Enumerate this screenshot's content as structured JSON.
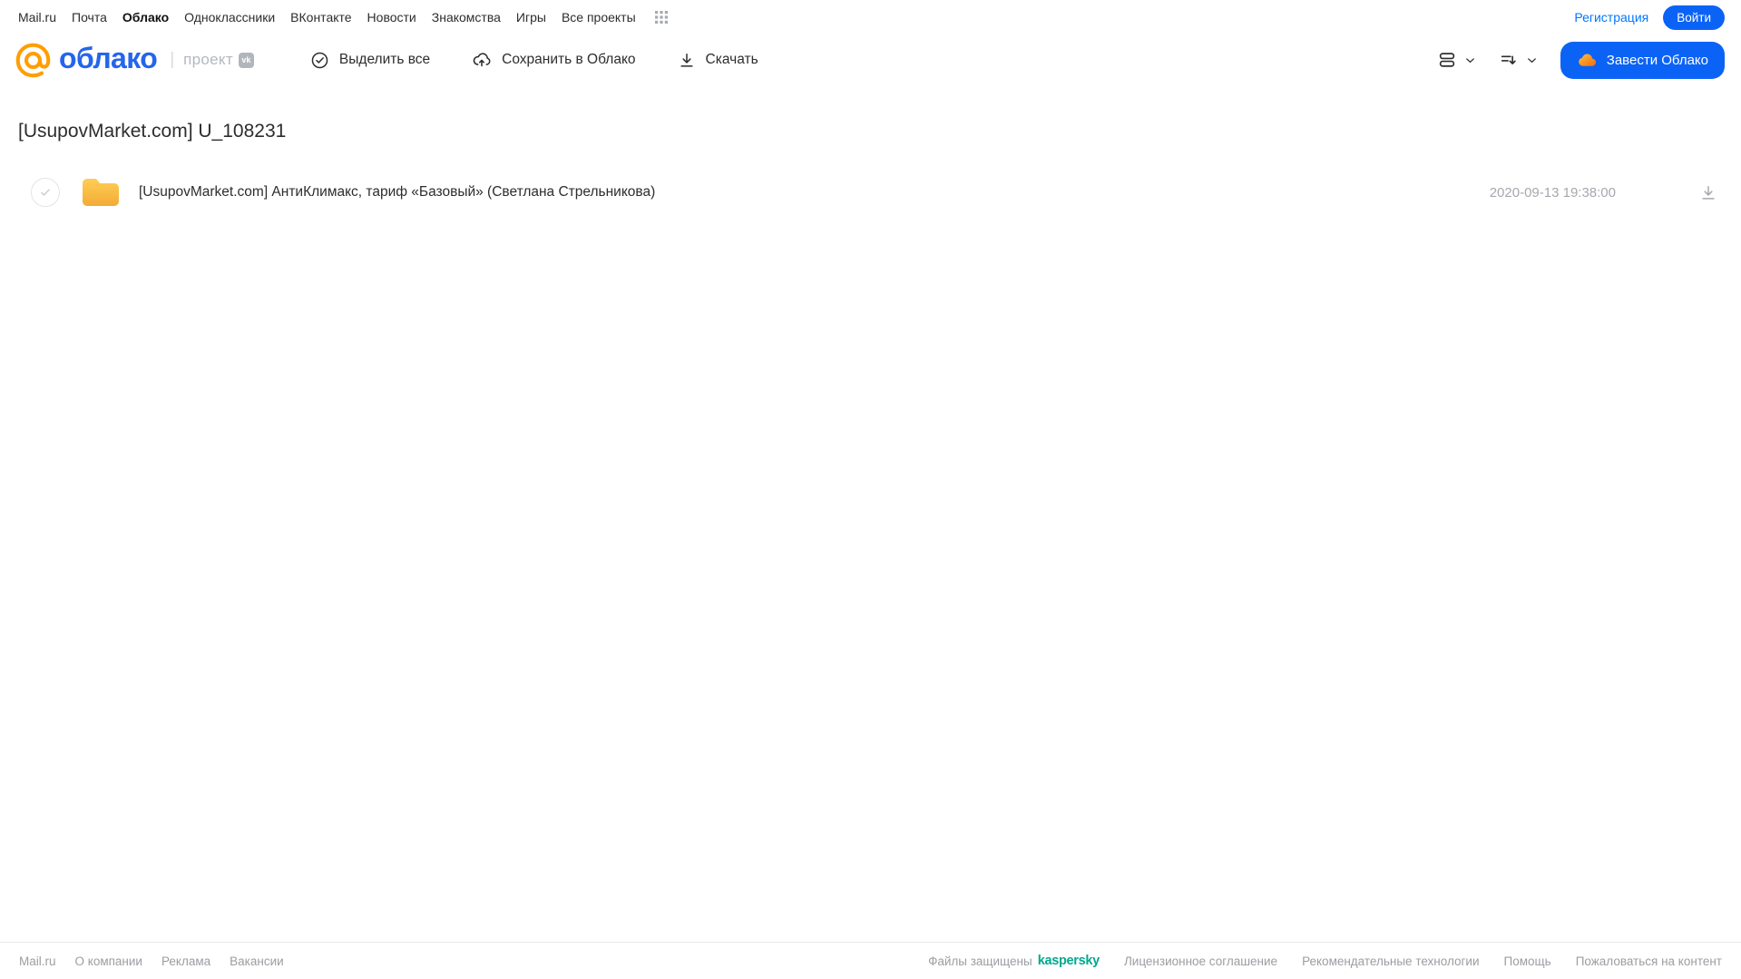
{
  "topnav": {
    "links": [
      "Mail.ru",
      "Почта",
      "Облако",
      "Одноклассники",
      "ВКонтакте",
      "Новости",
      "Знакомства",
      "Игры",
      "Все проекты"
    ],
    "register": "Регистрация",
    "login": "Войти"
  },
  "toolbar": {
    "brand": "облако",
    "divider": "|",
    "project": "проект",
    "vk_badge": "vk",
    "select_all": "Выделить все",
    "save_to_cloud": "Сохранить в Облако",
    "download": "Скачать",
    "create_cloud": "Завести Облако"
  },
  "main": {
    "title": "[UsupovMarket.com] U_108231",
    "files": [
      {
        "type": "folder",
        "name": "[UsupovMarket.com] АнтиКлимакс, тариф «Базовый» (Светлана Стрельникова)",
        "modified": "2020-09-13 19:38:00"
      }
    ]
  },
  "footer": {
    "left_links": [
      "Mail.ru",
      "О компании",
      "Реклама",
      "Вакансии"
    ],
    "protected_text": "Файлы защищены",
    "kaspersky_brand": "kaspersky",
    "right_links": [
      "Лицензионное соглашение",
      "Рекомендательные технологии",
      "Помощь",
      "Пожаловаться на контент"
    ]
  },
  "icons": {
    "grid": "apps-grid-icon",
    "select_all": "check-circle-icon",
    "save": "cloud-upload-icon",
    "download": "download-icon",
    "view": "view-rows-icon",
    "sort": "sort-icon",
    "cloud": "cloud-icon",
    "folder": "folder-icon"
  },
  "colors": {
    "accent_blue": "#0b63f6",
    "link_blue": "#0077ff",
    "brand_orange": "#ff9e00",
    "brand_blue": "#2565ec",
    "kaspersky_green": "#00a88e",
    "folder_yellow_top": "#ffce55",
    "folder_yellow_bottom": "#f3ab37",
    "text_dark": "#2c2d2e",
    "text_gray": "#a5a8ad"
  }
}
